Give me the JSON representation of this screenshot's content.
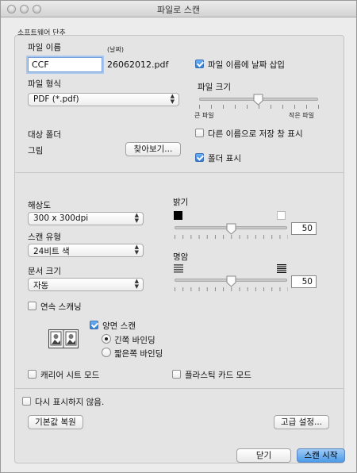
{
  "window": {
    "title": "파일로 스캔"
  },
  "software_button": {
    "group_label": "소프트웨어 단추",
    "file_name": {
      "label": "파일 이름",
      "date_caption": "(날짜)",
      "value": "CCF",
      "suffix": "26062012.pdf"
    },
    "insert_date": {
      "label": "파일 이름에 날짜 삽입",
      "checked": true
    },
    "file_type": {
      "label": "파일 형식",
      "value": "PDF (*.pdf)"
    },
    "file_size": {
      "label": "파일 크기",
      "left_caption": "큰 파일",
      "right_caption": "작은 파일",
      "level": 0.5
    },
    "target_folder": {
      "label": "대상 폴더",
      "value": "그림",
      "browse_label": "찾아보기..."
    },
    "show_save_as": {
      "label": "다른 이름으로 저장 창 표시",
      "checked": false
    },
    "show_folder": {
      "label": "폴더 표시",
      "checked": true
    }
  },
  "scan_settings": {
    "resolution": {
      "label": "해상도",
      "value": "300 x 300dpi"
    },
    "scan_type": {
      "label": "스캔 유형",
      "value": "24비트 색"
    },
    "document_size": {
      "label": "문서 크기",
      "value": "자동"
    },
    "brightness": {
      "label": "밝기",
      "value": "50"
    },
    "contrast": {
      "label": "명암",
      "value": "50"
    },
    "continuous_scan": {
      "label": "연속 스캐닝",
      "checked": false
    },
    "duplex": {
      "label": "양면 스캔",
      "checked": true,
      "options": [
        {
          "label": "긴쪽 바인딩",
          "selected": true
        },
        {
          "label": "짧은쪽 바인딩",
          "selected": false
        }
      ]
    },
    "carrier_sheet": {
      "label": "캐리어 시트 모드",
      "checked": false
    },
    "plastic_card": {
      "label": "플라스틱 카드 모드",
      "checked": false
    }
  },
  "footer": {
    "dont_show_again": {
      "label": "다시 표시하지 않음.",
      "checked": false
    },
    "restore_defaults_label": "기본값 복원",
    "advanced_label": "고급 설정...",
    "close_label": "닫기",
    "start_label": "스캔 시작"
  },
  "colors": {
    "accent": "#4c9be8",
    "window_bg": "#ececec"
  }
}
